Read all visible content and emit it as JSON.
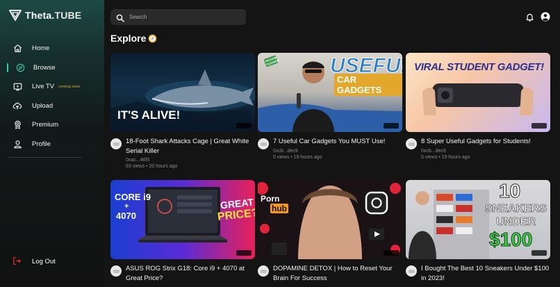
{
  "app": {
    "brand": "Theta.",
    "brand_suffix": "TUBE"
  },
  "sidebar": {
    "items": [
      {
        "label": "Home",
        "icon": "home-icon"
      },
      {
        "label": "Browse",
        "icon": "compass-icon",
        "active": true
      },
      {
        "label": "Live TV",
        "icon": "tv-icon",
        "badge": "coming soon"
      },
      {
        "label": "Upload",
        "icon": "upload-icon"
      },
      {
        "label": "Premium",
        "icon": "premium-icon"
      },
      {
        "label": "Profile",
        "icon": "profile-icon"
      }
    ],
    "logout": "Log Out"
  },
  "header": {
    "search_placeholder": "Search"
  },
  "page": {
    "heading": "Explore"
  },
  "colors": {
    "accent": "#2fd0b5",
    "soon": "#d8a93a",
    "logout": "#e0312c"
  },
  "videos": [
    {
      "title": "18-Foot Shark Attacks Cage | Great White Serial Killer",
      "channel": "0xac...46f5",
      "stats": "63 views • 20 hours ago",
      "thumb_text": [
        "IT'S ALIVE!"
      ]
    },
    {
      "title": "7 Useful Car Gadgets You MUST Use!",
      "channel": "0xcb...dec9",
      "stats": "0 views • 19 hours ago",
      "thumb_text": [
        "USEFUL",
        "CAR GADGETS",
        "VACUUM CLEANER"
      ]
    },
    {
      "title": "8 Super Useful Gadgets for Students!",
      "channel": "0xcb...dec9",
      "stats": "0 views • 19 hours ago",
      "thumb_text": [
        "VIRAL STUDENT GADGET!"
      ]
    },
    {
      "title": "ASUS ROG Strix G18: Core i9 + 4070 at Great Price?",
      "channel": "",
      "stats": "",
      "thumb_text": [
        "CORE i9",
        "+",
        "4070",
        "GREAT",
        "PRICE?"
      ]
    },
    {
      "title": "DOPAMINE DETOX | How to Reset Your Brain For Success",
      "channel": "",
      "stats": "",
      "thumb_text": [
        "Porn",
        "hub"
      ]
    },
    {
      "title": "I Bought The Best 10 Sneakers Under $100 in 2023!",
      "channel": "",
      "stats": "",
      "thumb_text": [
        "10",
        "SNEAKERS",
        "UNDER",
        "$100"
      ]
    }
  ]
}
